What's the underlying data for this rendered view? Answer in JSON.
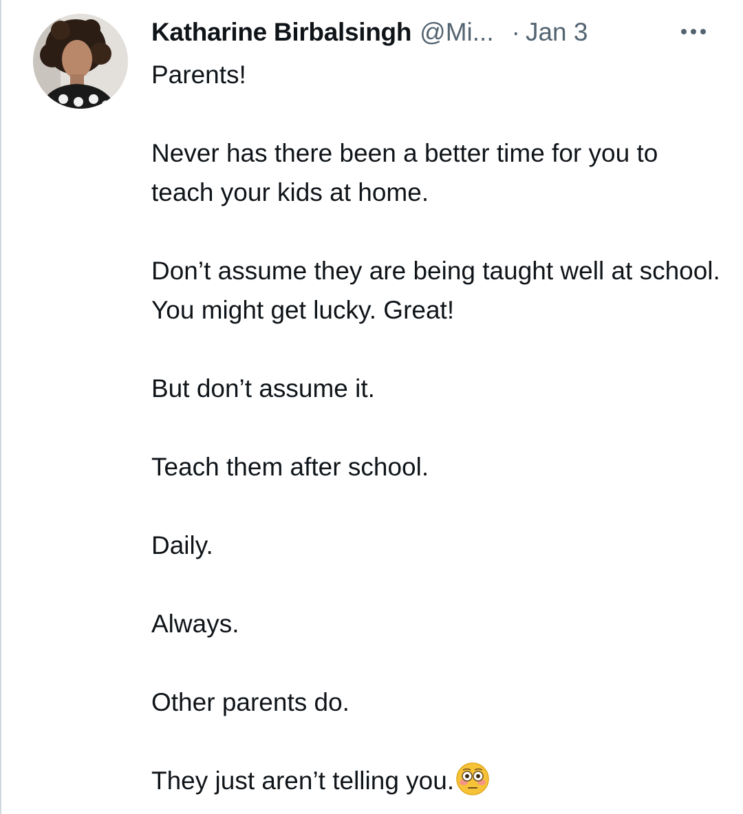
{
  "tweet": {
    "author_name": "Katharine Birbalsingh",
    "author_handle": "@Mi...",
    "separator": "·",
    "timestamp": "Jan 3",
    "more_icon": "more-horizontal-icon",
    "avatar_icon": "profile-photo",
    "paragraphs": [
      "Parents!",
      "Never has there been a better time for you to teach your kids at home.",
      "Don’t assume they are being taught well at school. You might get lucky. Great!",
      "But don’t assume it.",
      "Teach them after school.",
      "Daily.",
      "Always.",
      "Other parents do.",
      "They just aren’t telling you."
    ],
    "trailing_emoji": "flushed-face-emoji"
  },
  "colors": {
    "text": "#0f1419",
    "secondary": "#536471",
    "border": "#cfd9de",
    "emoji": "#f6c338"
  }
}
